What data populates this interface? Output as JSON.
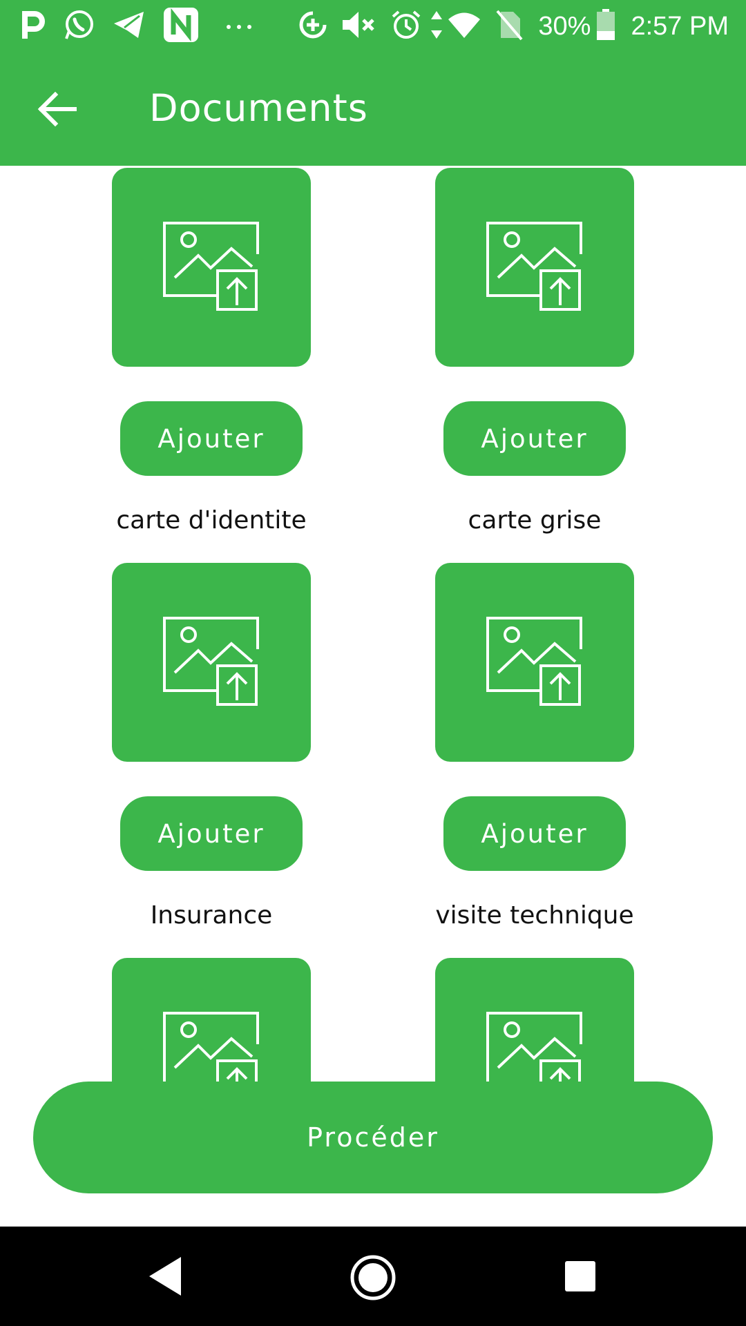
{
  "colors": {
    "accent": "#3cb64b",
    "text": "#111111",
    "navbar": "#000000"
  },
  "status_bar": {
    "left_icons": [
      "parking-p-icon",
      "whatsapp-icon",
      "telegram-icon",
      "n-app-icon",
      "more-dots-icon"
    ],
    "right_icons": [
      "data-saver-icon",
      "mute-icon",
      "alarm-icon",
      "data-arrows-icon",
      "wifi-icon",
      "no-sim-icon",
      "battery-icon"
    ],
    "battery": "30%",
    "time": "2:57 PM"
  },
  "app_bar": {
    "title": "Documents",
    "back_icon": "arrow-left-icon"
  },
  "documents": [
    {
      "label": "carte d'identite",
      "button": "Ajouter",
      "icon": "image-upload-icon"
    },
    {
      "label": "carte grise",
      "button": "Ajouter",
      "icon": "image-upload-icon"
    },
    {
      "label": "Insurance",
      "button": "Ajouter",
      "icon": "image-upload-icon"
    },
    {
      "label": "visite technique",
      "button": "Ajouter",
      "icon": "image-upload-icon"
    },
    {
      "label": "",
      "button": "",
      "icon": "image-upload-icon"
    },
    {
      "label": "",
      "button": "",
      "icon": "image-upload-icon"
    }
  ],
  "proceed": {
    "label": "Procéder"
  },
  "nav_bar": {
    "icons": [
      "nav-back-icon",
      "nav-home-icon",
      "nav-recents-icon"
    ]
  }
}
